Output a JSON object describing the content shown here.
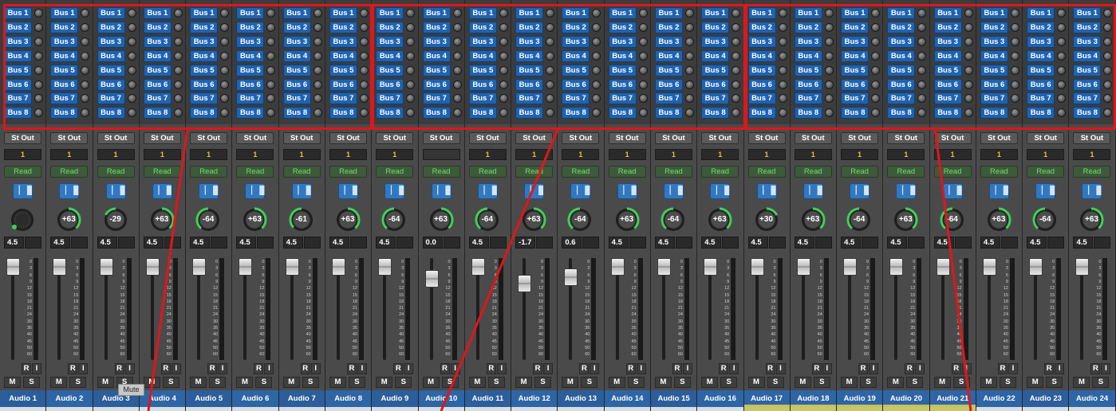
{
  "bus_labels": [
    "Bus 1",
    "Bus 2",
    "Bus 3",
    "Bus 4",
    "Bus 5",
    "Bus 6",
    "Bus 7",
    "Bus 8"
  ],
  "output_label": "St Out",
  "mute_label": "M",
  "solo_label": "S",
  "record_label": "R",
  "input_label": "I",
  "tooltip": "Mute",
  "colors": {
    "highlight": "#e0161a",
    "bus_button": "#1f63b0",
    "automation_text": "#6fe06b",
    "pan_arc": "#3fcf5a",
    "group_text": "#e9c23c"
  },
  "channels": [
    {
      "name": "Audio 1",
      "group": "1",
      "automation": "Read",
      "pan": "",
      "volume": "4.5",
      "fader_db": 4.5
    },
    {
      "name": "Audio 2",
      "group": "1",
      "automation": "Read",
      "pan": "+63",
      "volume": "4.5",
      "fader_db": 4.5
    },
    {
      "name": "Audio 3",
      "group": "1",
      "automation": "Read",
      "pan": "-29",
      "volume": "4.5",
      "fader_db": 4.5
    },
    {
      "name": "Audio 4",
      "group": "1",
      "automation": "Read",
      "pan": "+63",
      "volume": "4.5",
      "fader_db": 4.5
    },
    {
      "name": "Audio 5",
      "group": "1",
      "automation": "Read",
      "pan": "-64",
      "volume": "4.5",
      "fader_db": 4.5
    },
    {
      "name": "Audio 6",
      "group": "1",
      "automation": "Read",
      "pan": "+63",
      "volume": "4.5",
      "fader_db": 4.5
    },
    {
      "name": "Audio 7",
      "group": "1",
      "automation": "Read",
      "pan": "-61",
      "volume": "4.5",
      "fader_db": 4.5
    },
    {
      "name": "Audio 8",
      "group": "1",
      "automation": "Read",
      "pan": "+63",
      "volume": "4.5",
      "fader_db": 4.5
    },
    {
      "name": "Audio 9",
      "group": "1",
      "automation": "Read",
      "pan": "-64",
      "volume": "4.5",
      "fader_db": 4.5
    },
    {
      "name": "Audio 10",
      "group": "",
      "automation": "Read",
      "pan": "+63",
      "volume": "0.0",
      "fader_db": 0.0
    },
    {
      "name": "Audio 11",
      "group": "1",
      "automation": "Read",
      "pan": "-64",
      "volume": "4.5",
      "fader_db": 4.5
    },
    {
      "name": "Audio 12",
      "group": "1",
      "automation": "Read",
      "pan": "+63",
      "volume": "-1.7",
      "fader_db": -1.7
    },
    {
      "name": "Audio 13",
      "group": "1",
      "automation": "Read",
      "pan": "-64",
      "volume": "0.6",
      "fader_db": 0.6
    },
    {
      "name": "Audio 14",
      "group": "1",
      "automation": "Read",
      "pan": "+63",
      "volume": "4.5",
      "fader_db": 4.5
    },
    {
      "name": "Audio 15",
      "group": "1",
      "automation": "Read",
      "pan": "-64",
      "volume": "4.5",
      "fader_db": 4.5
    },
    {
      "name": "Audio 16",
      "group": "1",
      "automation": "Read",
      "pan": "+63",
      "volume": "4.5",
      "fader_db": 4.5
    },
    {
      "name": "Audio 17",
      "group": "1",
      "automation": "Read",
      "pan": "+30",
      "volume": "4.5",
      "fader_db": 4.5
    },
    {
      "name": "Audio 18",
      "group": "1",
      "automation": "Read",
      "pan": "+63",
      "volume": "4.5",
      "fader_db": 4.5
    },
    {
      "name": "Audio 19",
      "group": "1",
      "automation": "Read",
      "pan": "-64",
      "volume": "4.5",
      "fader_db": 4.5
    },
    {
      "name": "Audio 20",
      "group": "1",
      "automation": "Read",
      "pan": "+63",
      "volume": "4.5",
      "fader_db": 4.5
    },
    {
      "name": "Audio 21",
      "group": "1",
      "automation": "Read",
      "pan": "-64",
      "volume": "4.5",
      "fader_db": 4.5
    },
    {
      "name": "Audio 22",
      "group": "1",
      "automation": "Read",
      "pan": "+63",
      "volume": "4.5",
      "fader_db": 4.5
    },
    {
      "name": "Audio 23",
      "group": "1",
      "automation": "Read",
      "pan": "-64",
      "volume": "4.5",
      "fader_db": 4.5
    },
    {
      "name": "Audio 24",
      "group": "1",
      "automation": "Read",
      "pan": "+63",
      "volume": "4.5",
      "fader_db": 4.5
    }
  ],
  "fader_scale": [
    "0",
    "3",
    "6",
    "9",
    "12",
    "15",
    "18",
    "21",
    "24",
    "30",
    "35",
    "40",
    "45",
    "50",
    "60"
  ]
}
